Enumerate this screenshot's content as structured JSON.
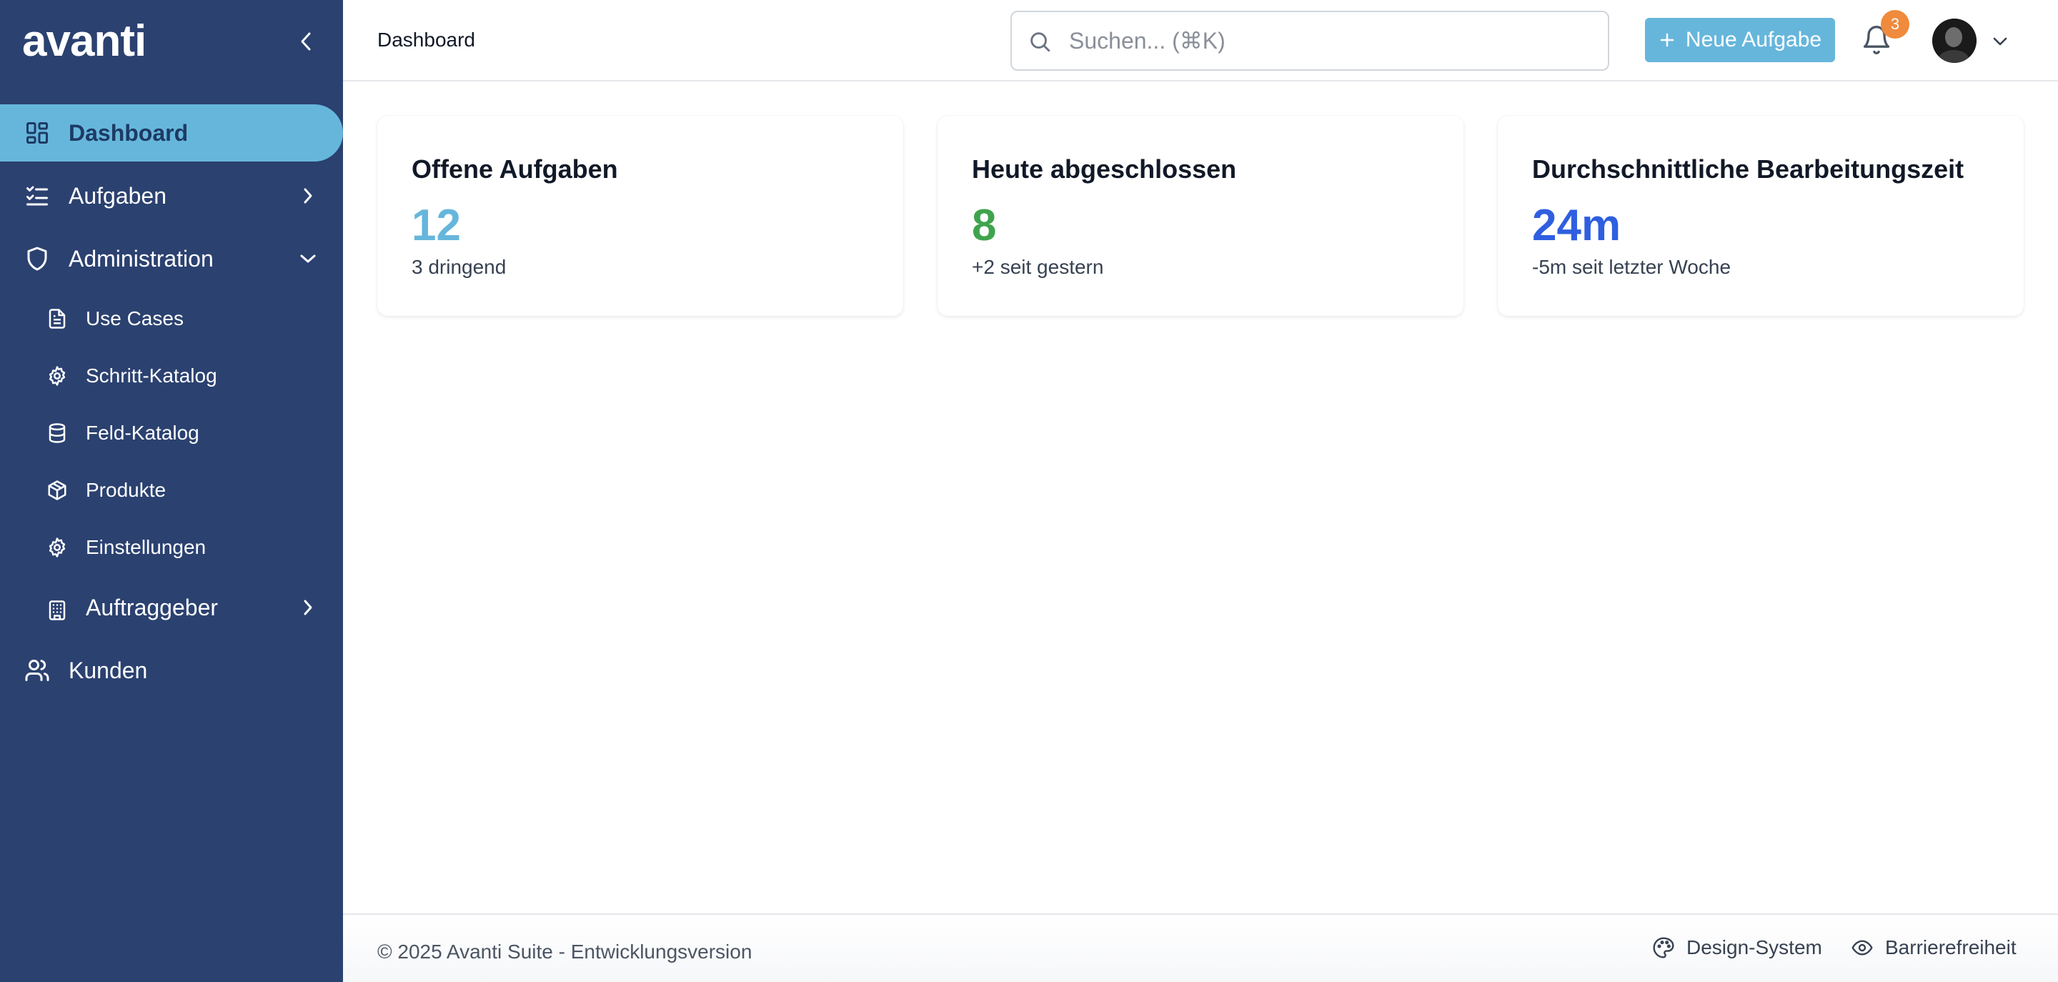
{
  "sidebar": {
    "logo": "avanti",
    "collapse_icon": "chevron-left-icon",
    "items": {
      "dashboard": {
        "label": "Dashboard",
        "icon": "layout-dashboard-icon"
      },
      "aufgaben": {
        "label": "Aufgaben",
        "icon": "list-checks-icon"
      },
      "administration": {
        "label": "Administration",
        "icon": "shield-icon"
      },
      "use_cases": {
        "label": "Use Cases",
        "icon": "file-text-icon"
      },
      "schritt_katalog": {
        "label": "Schritt-Katalog",
        "icon": "gear-icon"
      },
      "feld_katalog": {
        "label": "Feld-Katalog",
        "icon": "database-icon"
      },
      "produkte": {
        "label": "Produkte",
        "icon": "package-icon"
      },
      "einstellungen": {
        "label": "Einstellungen",
        "icon": "gear-icon"
      },
      "auftraggeber": {
        "label": "Auftraggeber",
        "icon": "building-icon"
      },
      "kunden": {
        "label": "Kunden",
        "icon": "users-icon"
      }
    },
    "active_color": "#66b6dc",
    "background": "#2b4170"
  },
  "header": {
    "breadcrumb": "Dashboard",
    "search_placeholder": "Suchen... (⌘K)",
    "new_task_label": "Neue Aufgabe",
    "notification_count": "3",
    "accent": "#66b6dc"
  },
  "cards": [
    {
      "title": "Offene Aufgaben",
      "value": "12",
      "subtitle": "3 dringend",
      "color": "#66b6dc"
    },
    {
      "title": "Heute abgeschlossen",
      "value": "8",
      "subtitle": "+2 seit gestern",
      "color": "#3fa34d"
    },
    {
      "title": "Durchschnittliche Bearbeitungszeit",
      "value": "24m",
      "subtitle": "-5m seit letzter Woche",
      "color": "#2f5fe0"
    }
  ],
  "footer": {
    "copyright": "© 2025 Avanti Suite - Entwicklungsversion",
    "design_system": "Design-System",
    "accessibility": "Barrierefreiheit"
  }
}
